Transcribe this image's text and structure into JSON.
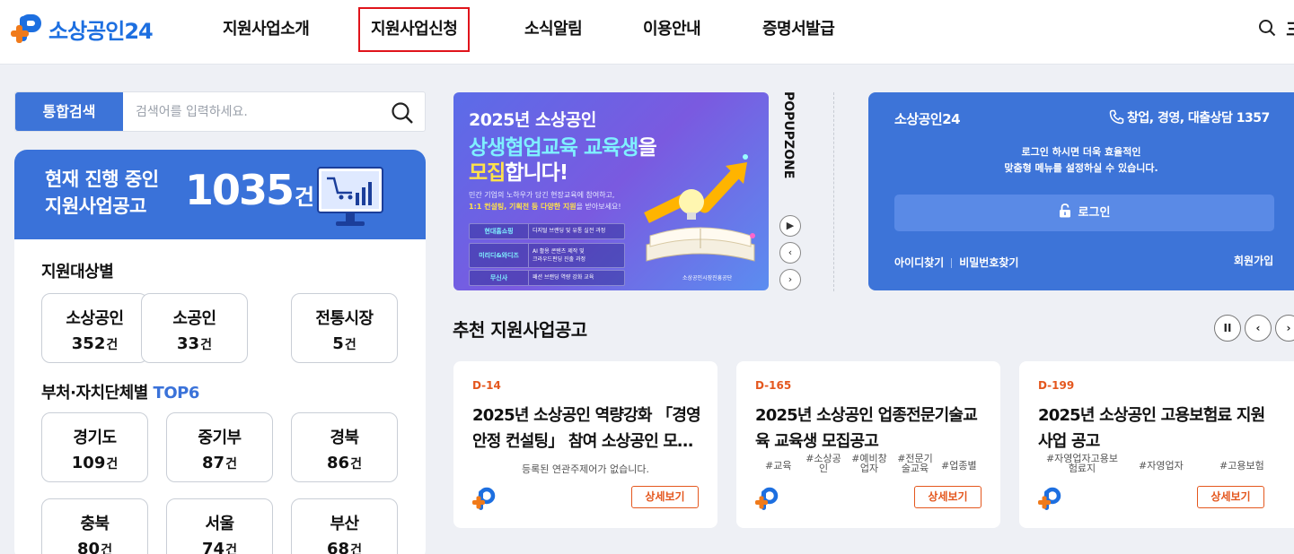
{
  "header": {
    "logo_text": "소상공인24",
    "nav": [
      "지원사업소개",
      "지원사업신청",
      "소식알림",
      "이용안내",
      "증명서발급"
    ],
    "menu_peek": "三"
  },
  "search": {
    "tab_label": "통합검색",
    "placeholder": "검색어를 입력하세요."
  },
  "summary": {
    "line1": "현재 진행 중인",
    "line2": "지원사업공고",
    "count": "1035",
    "unit": "건"
  },
  "targets": {
    "title": "지원대상별",
    "items": [
      {
        "name": "소상공인",
        "count": "352",
        "unit": "건"
      },
      {
        "name": "소공인",
        "count": "33",
        "unit": "건"
      },
      {
        "name": "전통시장",
        "count": "5",
        "unit": "건"
      }
    ]
  },
  "ministries": {
    "title": "부처·자치단체별",
    "title_hl": "TOP6",
    "items": [
      {
        "name": "경기도",
        "count": "109",
        "unit": "건"
      },
      {
        "name": "중기부",
        "count": "87",
        "unit": "건"
      },
      {
        "name": "경북",
        "count": "86",
        "unit": "건"
      },
      {
        "name": "충북",
        "count": "80",
        "unit": "건"
      },
      {
        "name": "서울",
        "count": "74",
        "unit": "건"
      },
      {
        "name": "부산",
        "count": "68",
        "unit": "건"
      }
    ]
  },
  "popup": {
    "label": "POPUPZONE",
    "line1": "2025년 소상공인",
    "line2a": "상생협업교육 교육생",
    "line2b": "을",
    "line3a": "모집",
    "line3b": "합니다!",
    "desc1": "민간 기업의 노하우가 담긴 현장교육에 참여하고,",
    "desc2a": "1:1 컨설팅, 기획전 등 다양한 지원",
    "desc2b": "을 받아보세요!",
    "rows": [
      {
        "k": "현대홈쇼핑",
        "v": "디지털 브랜딩 및 유통 실전 과정"
      },
      {
        "k": "미리디&와디즈",
        "v1": "AI 활용 콘텐츠 제작 및",
        "v2": "크라우드펀딩 진출 과정"
      },
      {
        "k": "무신사",
        "v": "패션 브랜딩 역량 강화 교육"
      }
    ],
    "badge": "소상공인시장진흥공단",
    "controls": [
      "▶",
      "‹",
      "›"
    ]
  },
  "login": {
    "title": "소상공인24",
    "phone": "창업, 경영, 대출상담 1357",
    "msg1": "로그인 하시면 더욱 효율적인",
    "msg2": "맞춤형 메뉴를 설정하실 수 있습니다.",
    "button": "로그인",
    "find_id": "아이디찾기",
    "find_pw": "비밀번호찾기",
    "join": "회원가입"
  },
  "recommended": {
    "title": "추천 지원사업공고",
    "controls": [
      "II",
      "‹",
      "›"
    ],
    "detail_label": "상세보기",
    "cards": [
      {
        "d": "D-14",
        "title": "2025년 소상공인 역량강화 「경영안정 컨설팅」 참여 소상공인 모…",
        "empty": "등록된 연관주제어가 없습니다."
      },
      {
        "d": "D-165",
        "title": "2025년 소상공인 업종전문기술교육 교육생 모집공고",
        "tags": [
          "#교육",
          "#소상공\n인",
          "#예비창\n업자",
          "#전문기\n술교육",
          "#업종별"
        ]
      },
      {
        "d": "D-199",
        "title": "2025년 소상공인 고용보험료 지원사업 공고",
        "tags": [
          "#자영업자고용보\n험료지",
          "#자영업자",
          "#고용보험"
        ]
      }
    ]
  },
  "colors": {
    "brand_blue": "#3a72d9",
    "brand_orange": "#e4571e",
    "active_outline": "#e0141b"
  }
}
